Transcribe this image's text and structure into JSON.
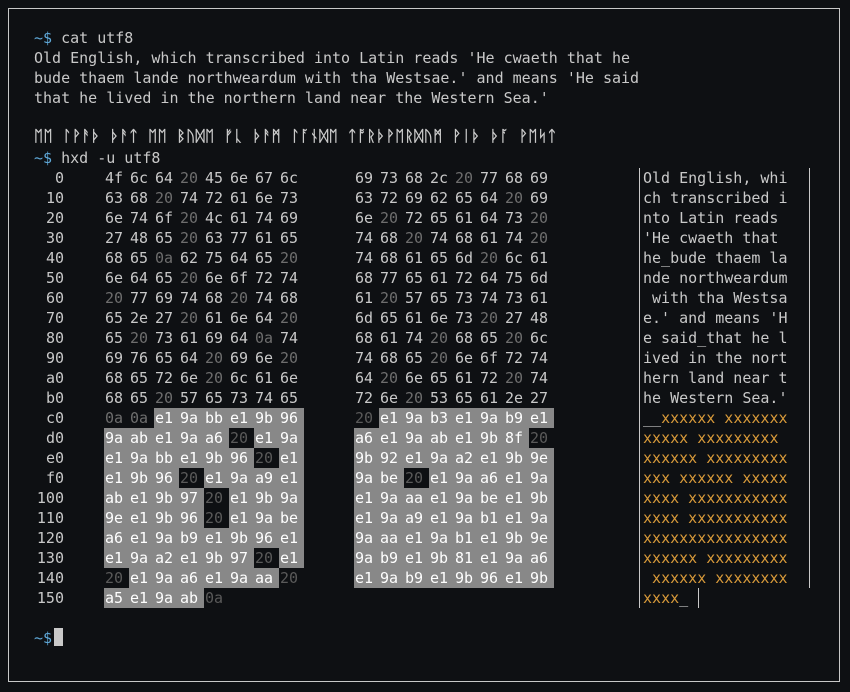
{
  "terminal": {
    "prompt": "~$",
    "command1": " cat utf8",
    "output_lines": [
      "Old English, which transcribed into Latin reads 'He cwaeth that he",
      "bude thaem lande northweardum with tha Westsae.' and means 'He said",
      "that he lived in the northern land near the Western Sea.'"
    ],
    "runic_line": "ᛖᛖ ᛚᚹᚨᚦ ᚦᚨᛏ ᛖᛖ ᛒᚢᛞᛖ ᚠᚳ ᚦᚨᛗ ᛚᚪᚾᛞᛖ ᛏᚩᚱᚦᚹᛖᚱᛞᚢᛗ ᚹᛁᚦ ᚦᚪ ᚹᛖᛋᛏ",
    "command2": " hxd -u utf8",
    "prompt_end": "~$"
  },
  "hexdump": {
    "rows": [
      {
        "offset": "0",
        "bytes": [
          "4f",
          "6c",
          "64",
          "20",
          "45",
          "6e",
          "67",
          "6c",
          "69",
          "73",
          "68",
          "2c",
          "20",
          "77",
          "68",
          "69"
        ],
        "ascii": "Old English, whi"
      },
      {
        "offset": "10",
        "bytes": [
          "63",
          "68",
          "20",
          "74",
          "72",
          "61",
          "6e",
          "73",
          "63",
          "72",
          "69",
          "62",
          "65",
          "64",
          "20",
          "69"
        ],
        "ascii": "ch transcribed i"
      },
      {
        "offset": "20",
        "bytes": [
          "6e",
          "74",
          "6f",
          "20",
          "4c",
          "61",
          "74",
          "69",
          "6e",
          "20",
          "72",
          "65",
          "61",
          "64",
          "73",
          "20"
        ],
        "ascii": "nto Latin reads "
      },
      {
        "offset": "30",
        "bytes": [
          "27",
          "48",
          "65",
          "20",
          "63",
          "77",
          "61",
          "65",
          "74",
          "68",
          "20",
          "74",
          "68",
          "61",
          "74",
          "20"
        ],
        "ascii": "'He cwaeth that "
      },
      {
        "offset": "40",
        "bytes": [
          "68",
          "65",
          "0a",
          "62",
          "75",
          "64",
          "65",
          "20",
          "74",
          "68",
          "61",
          "65",
          "6d",
          "20",
          "6c",
          "61"
        ],
        "ascii": "he_bude thaem la"
      },
      {
        "offset": "50",
        "bytes": [
          "6e",
          "64",
          "65",
          "20",
          "6e",
          "6f",
          "72",
          "74",
          "68",
          "77",
          "65",
          "61",
          "72",
          "64",
          "75",
          "6d"
        ],
        "ascii": "nde northweardum"
      },
      {
        "offset": "60",
        "bytes": [
          "20",
          "77",
          "69",
          "74",
          "68",
          "20",
          "74",
          "68",
          "61",
          "20",
          "57",
          "65",
          "73",
          "74",
          "73",
          "61"
        ],
        "ascii": " with tha Westsa"
      },
      {
        "offset": "70",
        "bytes": [
          "65",
          "2e",
          "27",
          "20",
          "61",
          "6e",
          "64",
          "20",
          "6d",
          "65",
          "61",
          "6e",
          "73",
          "20",
          "27",
          "48"
        ],
        "ascii": "e.' and means 'H"
      },
      {
        "offset": "80",
        "bytes": [
          "65",
          "20",
          "73",
          "61",
          "69",
          "64",
          "0a",
          "74",
          "68",
          "61",
          "74",
          "20",
          "68",
          "65",
          "20",
          "6c"
        ],
        "ascii": "e said_that he l"
      },
      {
        "offset": "90",
        "bytes": [
          "69",
          "76",
          "65",
          "64",
          "20",
          "69",
          "6e",
          "20",
          "74",
          "68",
          "65",
          "20",
          "6e",
          "6f",
          "72",
          "74"
        ],
        "ascii": "ived in the nort"
      },
      {
        "offset": "a0",
        "bytes": [
          "68",
          "65",
          "72",
          "6e",
          "20",
          "6c",
          "61",
          "6e",
          "64",
          "20",
          "6e",
          "65",
          "61",
          "72",
          "20",
          "74"
        ],
        "ascii": "hern land near t"
      },
      {
        "offset": "b0",
        "bytes": [
          "68",
          "65",
          "20",
          "57",
          "65",
          "73",
          "74",
          "65",
          "72",
          "6e",
          "20",
          "53",
          "65",
          "61",
          "2e",
          "27"
        ],
        "ascii": "he Western Sea.'"
      },
      {
        "offset": "c0",
        "bytes": [
          "0a",
          "0a",
          "e1",
          "9a",
          "bb",
          "e1",
          "9b",
          "96",
          "20",
          "e1",
          "9a",
          "b3",
          "e1",
          "9a",
          "b9",
          "e1"
        ],
        "ascii": "__xxxxxx xxxxxxx"
      },
      {
        "offset": "d0",
        "bytes": [
          "9a",
          "ab",
          "e1",
          "9a",
          "a6",
          "20",
          "e1",
          "9a",
          "a6",
          "e1",
          "9a",
          "ab",
          "e1",
          "9b",
          "8f",
          "20"
        ],
        "ascii": "xxxxx xxxxxxxxx "
      },
      {
        "offset": "e0",
        "bytes": [
          "e1",
          "9a",
          "bb",
          "e1",
          "9b",
          "96",
          "20",
          "e1",
          "9b",
          "92",
          "e1",
          "9a",
          "a2",
          "e1",
          "9b",
          "9e"
        ],
        "ascii": "xxxxxx xxxxxxxxx"
      },
      {
        "offset": "f0",
        "bytes": [
          "e1",
          "9b",
          "96",
          "20",
          "e1",
          "9a",
          "a9",
          "e1",
          "9a",
          "be",
          "20",
          "e1",
          "9a",
          "a6",
          "e1",
          "9a"
        ],
        "ascii": "xxx xxxxxx xxxxx"
      },
      {
        "offset": "100",
        "bytes": [
          "ab",
          "e1",
          "9b",
          "97",
          "20",
          "e1",
          "9b",
          "9a",
          "e1",
          "9a",
          "aa",
          "e1",
          "9a",
          "be",
          "e1",
          "9b"
        ],
        "ascii": "xxxx xxxxxxxxxxx"
      },
      {
        "offset": "110",
        "bytes": [
          "9e",
          "e1",
          "9b",
          "96",
          "20",
          "e1",
          "9a",
          "be",
          "e1",
          "9a",
          "a9",
          "e1",
          "9a",
          "b1",
          "e1",
          "9a"
        ],
        "ascii": "xxxx xxxxxxxxxxx"
      },
      {
        "offset": "120",
        "bytes": [
          "a6",
          "e1",
          "9a",
          "b9",
          "e1",
          "9b",
          "96",
          "e1",
          "9a",
          "aa",
          "e1",
          "9a",
          "b1",
          "e1",
          "9b",
          "9e"
        ],
        "ascii": "xxxxxxxxxxxxxxxx"
      },
      {
        "offset": "130",
        "bytes": [
          "e1",
          "9a",
          "a2",
          "e1",
          "9b",
          "97",
          "20",
          "e1",
          "9a",
          "b9",
          "e1",
          "9b",
          "81",
          "e1",
          "9a",
          "a6"
        ],
        "ascii": "xxxxxx xxxxxxxxx"
      },
      {
        "offset": "140",
        "bytes": [
          "20",
          "e1",
          "9a",
          "a6",
          "e1",
          "9a",
          "aa",
          "20",
          "e1",
          "9a",
          "b9",
          "e1",
          "9b",
          "96",
          "e1",
          "9b"
        ],
        "ascii": " xxxxxx xxxxxxxx"
      },
      {
        "offset": "150",
        "bytes": [
          "a5",
          "e1",
          "9a",
          "ab",
          "0a"
        ],
        "ascii": "xxxx_"
      }
    ]
  }
}
